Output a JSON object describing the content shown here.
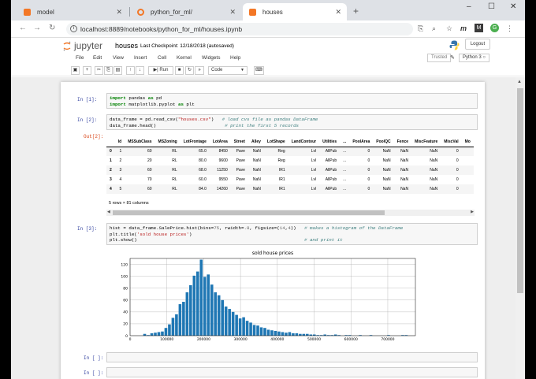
{
  "browser": {
    "tabs": [
      {
        "label": "model",
        "favicon_color": "#f37726"
      },
      {
        "label": "python_for_ml/",
        "favicon_color": "#f37726"
      },
      {
        "label": "houses",
        "favicon_color": "#f37726",
        "active": true
      }
    ],
    "new_tab": "+",
    "url": "localhost:8889/notebooks/python_for_ml/houses.ipynb",
    "window_controls": [
      "–",
      "☐",
      "✕"
    ],
    "profile_initial": "G"
  },
  "jupyter": {
    "logo_text": "jupyter",
    "notebook_name": "houses",
    "checkpoint": "Last Checkpoint: 12/18/2018  (autosaved)",
    "logout_label": "Logout",
    "menu": [
      "File",
      "Edit",
      "View",
      "Insert",
      "Cell",
      "Kernel",
      "Widgets",
      "Help"
    ],
    "trusted_label": "Trusted",
    "kernel_label": "Python 3",
    "toolbar": {
      "run_label": "Run",
      "cell_type": "Code"
    }
  },
  "cells": [
    {
      "prompt": "In [1]:",
      "code_lines": [
        "import pandas as pd",
        "import matplotlib.pyplot as plt"
      ]
    },
    {
      "prompt": "In [2]:",
      "code_lines": [
        "data_frame = pd.read_csv(\"houses.csv\")   # load cvs file as pandas DataFrame",
        "data_frame.head()                         # print the first 5 records"
      ],
      "out_prompt": "Out[2]:"
    },
    {
      "prompt": "In [3]:",
      "code_lines": [
        "hist = data_frame.SalePrice.hist(bins=75, rwidth=.8, figsize=(14,4))   # makes a histogram of the DataFrame",
        "plt.title('sold house prices')",
        "plt.show()                                                             # and print it"
      ]
    },
    {
      "prompt": "In [ ]:"
    },
    {
      "prompt": "In [ ]:"
    }
  ],
  "dataframe": {
    "columns": [
      "",
      "Id",
      "MSSubClass",
      "MSZoning",
      "LotFrontage",
      "LotArea",
      "Street",
      "Alley",
      "LotShape",
      "LandContour",
      "Utilities",
      "...",
      "PoolArea",
      "PoolQC",
      "Fence",
      "MiscFeature",
      "MiscVal",
      "Mo"
    ],
    "rows": [
      [
        "0",
        "1",
        "60",
        "RL",
        "65.0",
        "8450",
        "Pave",
        "NaN",
        "Reg",
        "Lvl",
        "AllPub",
        "...",
        "0",
        "NaN",
        "NaN",
        "NaN",
        "0",
        ""
      ],
      [
        "1",
        "2",
        "20",
        "RL",
        "80.0",
        "9600",
        "Pave",
        "NaN",
        "Reg",
        "Lvl",
        "AllPub",
        "...",
        "0",
        "NaN",
        "NaN",
        "NaN",
        "0",
        ""
      ],
      [
        "2",
        "3",
        "60",
        "RL",
        "68.0",
        "11250",
        "Pave",
        "NaN",
        "IR1",
        "Lvl",
        "AllPub",
        "...",
        "0",
        "NaN",
        "NaN",
        "NaN",
        "0",
        ""
      ],
      [
        "3",
        "4",
        "70",
        "RL",
        "60.0",
        "9550",
        "Pave",
        "NaN",
        "IR1",
        "Lvl",
        "AllPub",
        "...",
        "0",
        "NaN",
        "NaN",
        "NaN",
        "0",
        ""
      ],
      [
        "4",
        "5",
        "60",
        "RL",
        "84.0",
        "14260",
        "Pave",
        "NaN",
        "IR1",
        "Lvl",
        "AllPub",
        "...",
        "0",
        "NaN",
        "NaN",
        "NaN",
        "0",
        ""
      ]
    ],
    "row_count": "5 rows × 81 columns"
  },
  "chart_data": {
    "type": "bar",
    "title": "sold house prices",
    "xlabel": "",
    "ylabel": "",
    "x_ticks": [
      "0",
      "100000",
      "200000",
      "300000",
      "400000",
      "500000",
      "600000",
      "700000"
    ],
    "y_ticks": [
      "0",
      "20",
      "40",
      "60",
      "80",
      "100",
      "120"
    ],
    "xlim": [
      0,
      775000
    ],
    "ylim": [
      0,
      130
    ],
    "grid": true,
    "bar_color": "#1f77b4",
    "bin_start": 34900,
    "bin_width": 9600,
    "values": [
      3,
      1,
      4,
      5,
      6,
      7,
      13,
      19,
      30,
      36,
      53,
      57,
      73,
      85,
      101,
      108,
      128,
      99,
      103,
      86,
      73,
      68,
      60,
      49,
      45,
      40,
      35,
      29,
      31,
      25,
      22,
      18,
      17,
      14,
      13,
      10,
      9,
      8,
      7,
      6,
      5,
      6,
      4,
      4,
      3,
      3,
      3,
      2,
      2,
      1,
      1,
      2,
      1,
      1,
      2,
      1,
      0,
      1,
      1,
      0,
      0,
      1,
      0,
      0,
      1,
      0,
      0,
      0,
      0,
      1,
      0,
      0,
      0,
      1,
      1
    ]
  }
}
